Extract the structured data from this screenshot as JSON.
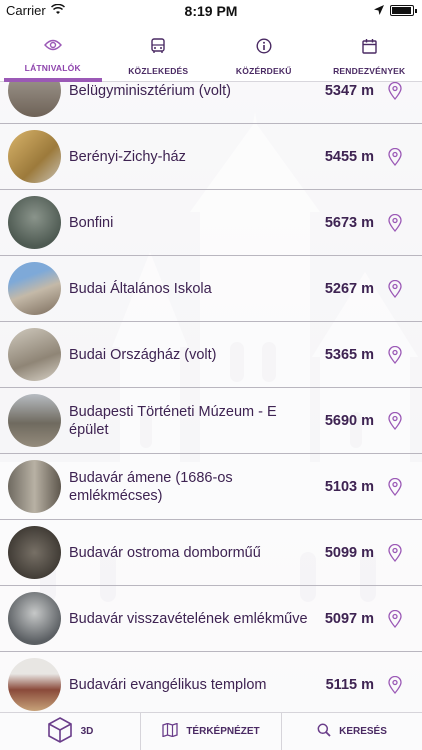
{
  "status_bar": {
    "carrier": "Carrier",
    "time": "8:19 PM"
  },
  "tabs": [
    {
      "label": "LÁTNIVALÓK",
      "icon": "eye-icon",
      "active": true
    },
    {
      "label": "KÖZLEKEDÉS",
      "icon": "bus-icon",
      "active": false
    },
    {
      "label": "KÖZÉRDEKŰ",
      "icon": "info-icon",
      "active": false
    },
    {
      "label": "RENDEZVÉNYEK",
      "icon": "calendar-icon",
      "active": false
    }
  ],
  "sights": [
    {
      "name": "Belügyminisztérium (volt)",
      "distance": "5347 m"
    },
    {
      "name": "Berényi-Zichy-ház",
      "distance": "5455 m"
    },
    {
      "name": "Bonfini",
      "distance": "5673 m"
    },
    {
      "name": "Budai Általános Iskola",
      "distance": "5267 m"
    },
    {
      "name": "Budai Országház (volt)",
      "distance": "5365 m"
    },
    {
      "name": "Budapesti Történeti Múzeum - E épület",
      "distance": "5690 m"
    },
    {
      "name": "Budavár ámene (1686-os emlékmécses)",
      "distance": "5103 m"
    },
    {
      "name": "Budavár ostroma domborműű",
      "distance": "5099 m"
    },
    {
      "name": "Budavár visszavételének emlékműve",
      "distance": "5097 m"
    },
    {
      "name": "Budavári evangélikus templom",
      "distance": "5115 m"
    }
  ],
  "bottom_bar": {
    "btn_3d": "3D",
    "btn_map": "TÉRKÉPNÉZET",
    "btn_search": "KERESÉS"
  },
  "colors": {
    "accent": "#9b59b6",
    "text": "#3e2352"
  }
}
